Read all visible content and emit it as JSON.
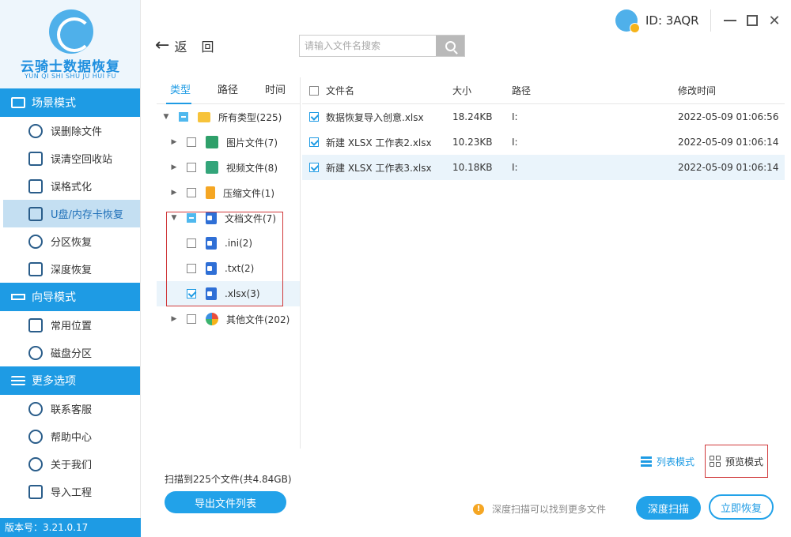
{
  "app": {
    "title": "云骑士数据恢复",
    "subtitle": "YUN QI SHI SHU JU HUI FU",
    "version": "版本号：3.21.0.17"
  },
  "user": {
    "id_label": "ID: 3AQR"
  },
  "window_controls": {
    "close": "✕"
  },
  "sidebar": {
    "sections": [
      {
        "title": "场景模式",
        "icon": "scene-icon",
        "items": [
          {
            "label": "误删除文件",
            "icon": "file-delete-icon"
          },
          {
            "label": "误清空回收站",
            "icon": "recycle-bin-icon"
          },
          {
            "label": "误格式化",
            "icon": "format-icon"
          },
          {
            "label": "U盘/内存卡恢复",
            "icon": "usb-drive-icon",
            "active": true
          },
          {
            "label": "分区恢复",
            "icon": "partition-icon"
          },
          {
            "label": "深度恢复",
            "icon": "deep-recovery-icon"
          }
        ]
      },
      {
        "title": "向导模式",
        "icon": "signpost-icon",
        "items": [
          {
            "label": "常用位置",
            "icon": "windows-icon"
          },
          {
            "label": "磁盘分区",
            "icon": "disk-icon"
          }
        ]
      },
      {
        "title": "更多选项",
        "icon": "menu-icon",
        "items": [
          {
            "label": "联系客服",
            "icon": "phone-icon"
          },
          {
            "label": "帮助中心",
            "icon": "help-icon"
          },
          {
            "label": "关于我们",
            "icon": "info-icon"
          },
          {
            "label": "导入工程",
            "icon": "import-icon"
          }
        ]
      }
    ]
  },
  "toolbar": {
    "back_label": "返回",
    "search_placeholder": "请输入文件名搜索"
  },
  "tree": {
    "tabs": [
      "类型",
      "路径",
      "时间"
    ],
    "active_tab": 0,
    "rows": [
      {
        "label": "所有类型(225)",
        "icon": "folder-icon",
        "state": "partial",
        "caret": "▼",
        "level": 0
      },
      {
        "label": "图片文件(7)",
        "icon": "image-icon",
        "state": "unchecked",
        "caret": "▶",
        "level": 1
      },
      {
        "label": "视频文件(8)",
        "icon": "video-icon",
        "state": "unchecked",
        "caret": "▶",
        "level": 1
      },
      {
        "label": "压缩文件(1)",
        "icon": "zip-icon",
        "state": "unchecked",
        "caret": "▶",
        "level": 1
      },
      {
        "label": "文档文件(7)",
        "icon": "document-icon",
        "state": "partial",
        "caret": "▼",
        "level": 1
      },
      {
        "label": ".ini(2)",
        "icon": "document-icon",
        "state": "unchecked",
        "caret": "",
        "level": 2
      },
      {
        "label": ".txt(2)",
        "icon": "document-icon",
        "state": "unchecked",
        "caret": "",
        "level": 2
      },
      {
        "label": ".xlsx(3)",
        "icon": "document-icon",
        "state": "checked",
        "caret": "",
        "level": 2,
        "selected": true
      },
      {
        "label": "其他文件(202)",
        "icon": "other-files-icon",
        "state": "unchecked",
        "caret": "▶",
        "level": 1
      }
    ]
  },
  "files": {
    "columns": {
      "name": "文件名",
      "size": "大小",
      "path": "路径",
      "modified": "修改时间"
    },
    "rows": [
      {
        "name": "数据恢复导入创意.xlsx",
        "size": "18.24KB",
        "path": "I:",
        "modified": "2022-05-09 01:06:56",
        "checked": true
      },
      {
        "name": "新建 XLSX 工作表2.xlsx",
        "size": "10.23KB",
        "path": "I:",
        "modified": "2022-05-09 01:06:14",
        "checked": true
      },
      {
        "name": "新建 XLSX 工作表3.xlsx",
        "size": "10.18KB",
        "path": "I:",
        "modified": "2022-05-09 01:06:14",
        "checked": true,
        "selected": true
      }
    ]
  },
  "bottom": {
    "scan_summary": "扫描到225个文件(共4.84GB)",
    "export_label": "导出文件列表",
    "list_mode_label": "列表模式",
    "preview_mode_label": "预览模式",
    "hint": "深度扫描可以找到更多文件",
    "deep_scan_label": "深度扫描",
    "recover_label": "立即恢复"
  },
  "colors": {
    "accent": "#1e9be4",
    "sidebar_active": "#c4dff2",
    "highlight_border": "#d0393b"
  }
}
